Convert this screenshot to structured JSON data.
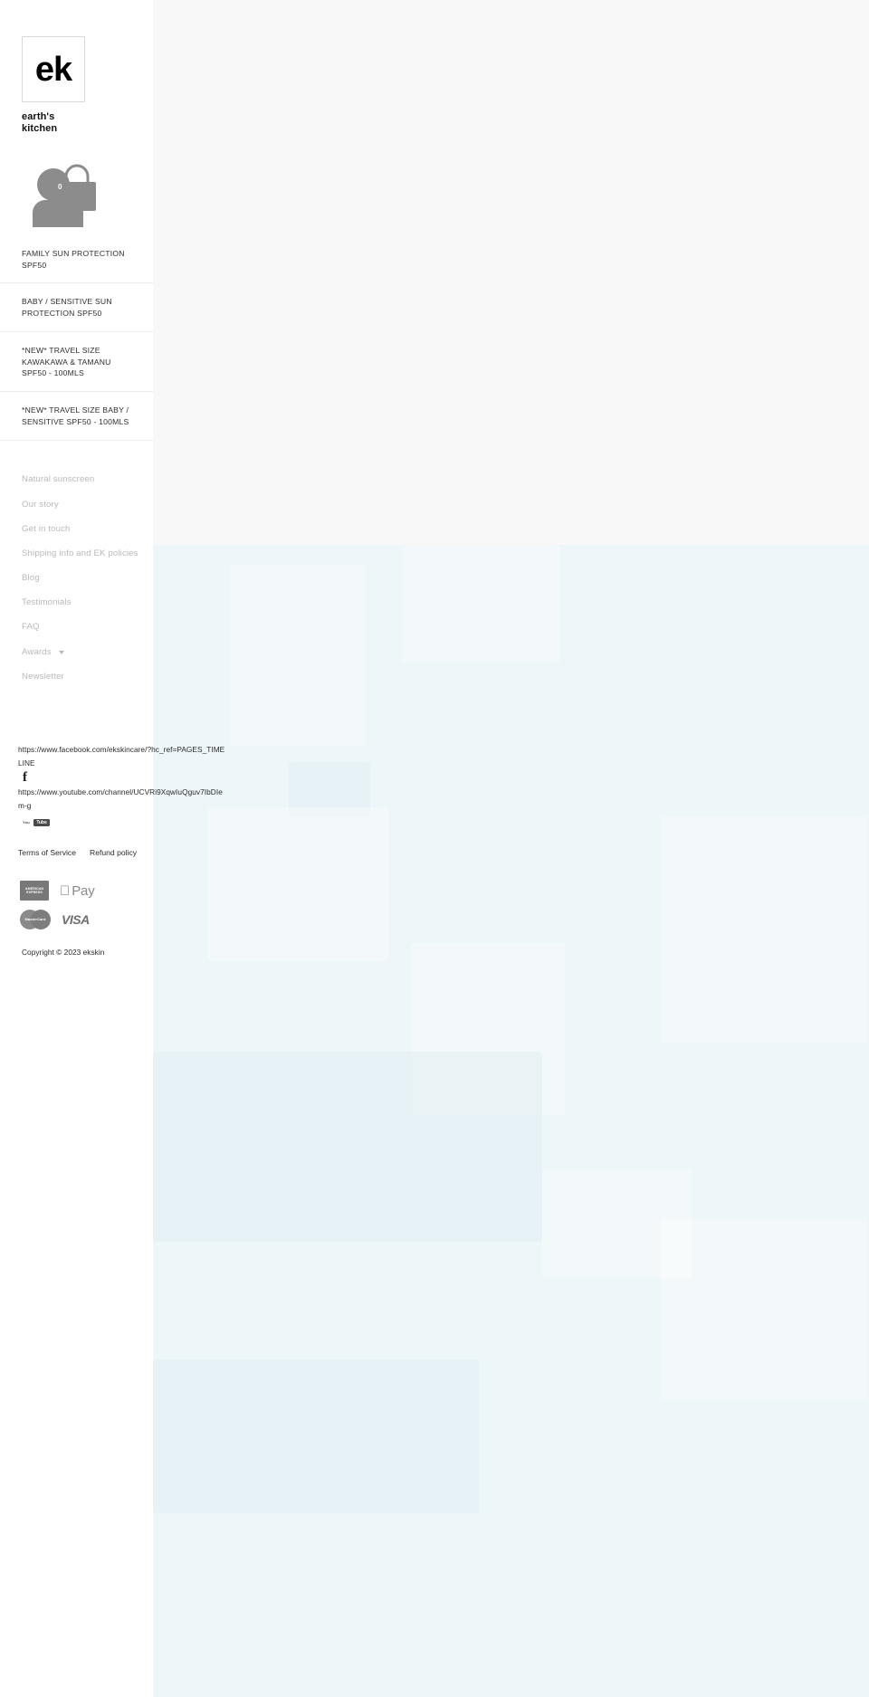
{
  "brand": {
    "logo_mark": "ek",
    "logo_line1": "earth's",
    "logo_line2": "kitchen"
  },
  "header_icons": {
    "account": "account-icon",
    "cart": "cart-icon",
    "cart_count": "0"
  },
  "product_nav": {
    "items": [
      {
        "label": "FAMILY SUN PROTECTION SPF50"
      },
      {
        "label": "BABY / SENSITIVE SUN PROTECTION SPF50"
      },
      {
        "label": "*NEW* TRAVEL SIZE KAWAKAWA & TAMANU SPF50 - 100MLS"
      },
      {
        "label": "*NEW* TRAVEL SIZE BABY / SENSITIVE SPF50 - 100MLS"
      }
    ]
  },
  "secondary_nav": {
    "items": [
      {
        "label": "Natural sunscreen",
        "has_caret": false
      },
      {
        "label": "Our story",
        "has_caret": false
      },
      {
        "label": "Get in touch",
        "has_caret": false
      },
      {
        "label": "Shipping info and EK policies",
        "has_caret": false
      },
      {
        "label": "Blog",
        "has_caret": false
      },
      {
        "label": "Testimonials",
        "has_caret": false
      },
      {
        "label": "FAQ",
        "has_caret": false
      },
      {
        "label": "Awards",
        "has_caret": true
      },
      {
        "label": "Newsletter",
        "has_caret": false
      }
    ]
  },
  "social": {
    "facebook_url": "https://www.facebook.com/ekskincare/?hc_ref=PAGES_TIMELINE",
    "facebook_icon": "facebook-icon",
    "youtube_url": "https://www.youtube.com/channel/UCVRi9XqwIuQguv7IbDIem-g",
    "youtube_icon_top": "You",
    "youtube_icon_box": "Tube"
  },
  "policies": {
    "terms": "Terms of Service",
    "refund": "Refund policy"
  },
  "payments": {
    "items": [
      {
        "name": "american-express",
        "line1": "AMERICAN",
        "line2": "EXPRESS"
      },
      {
        "name": "apple-pay",
        "mark": "\u0000",
        "word": "Pay"
      },
      {
        "name": "mastercard",
        "label": "MasterCard"
      },
      {
        "name": "visa",
        "label": "VISA"
      }
    ]
  },
  "footer": {
    "copyright": "Copyright © 2023 ekskin"
  },
  "main": {
    "top_bg": "#f8f8f8",
    "hero_bg": "#edf6f9"
  }
}
